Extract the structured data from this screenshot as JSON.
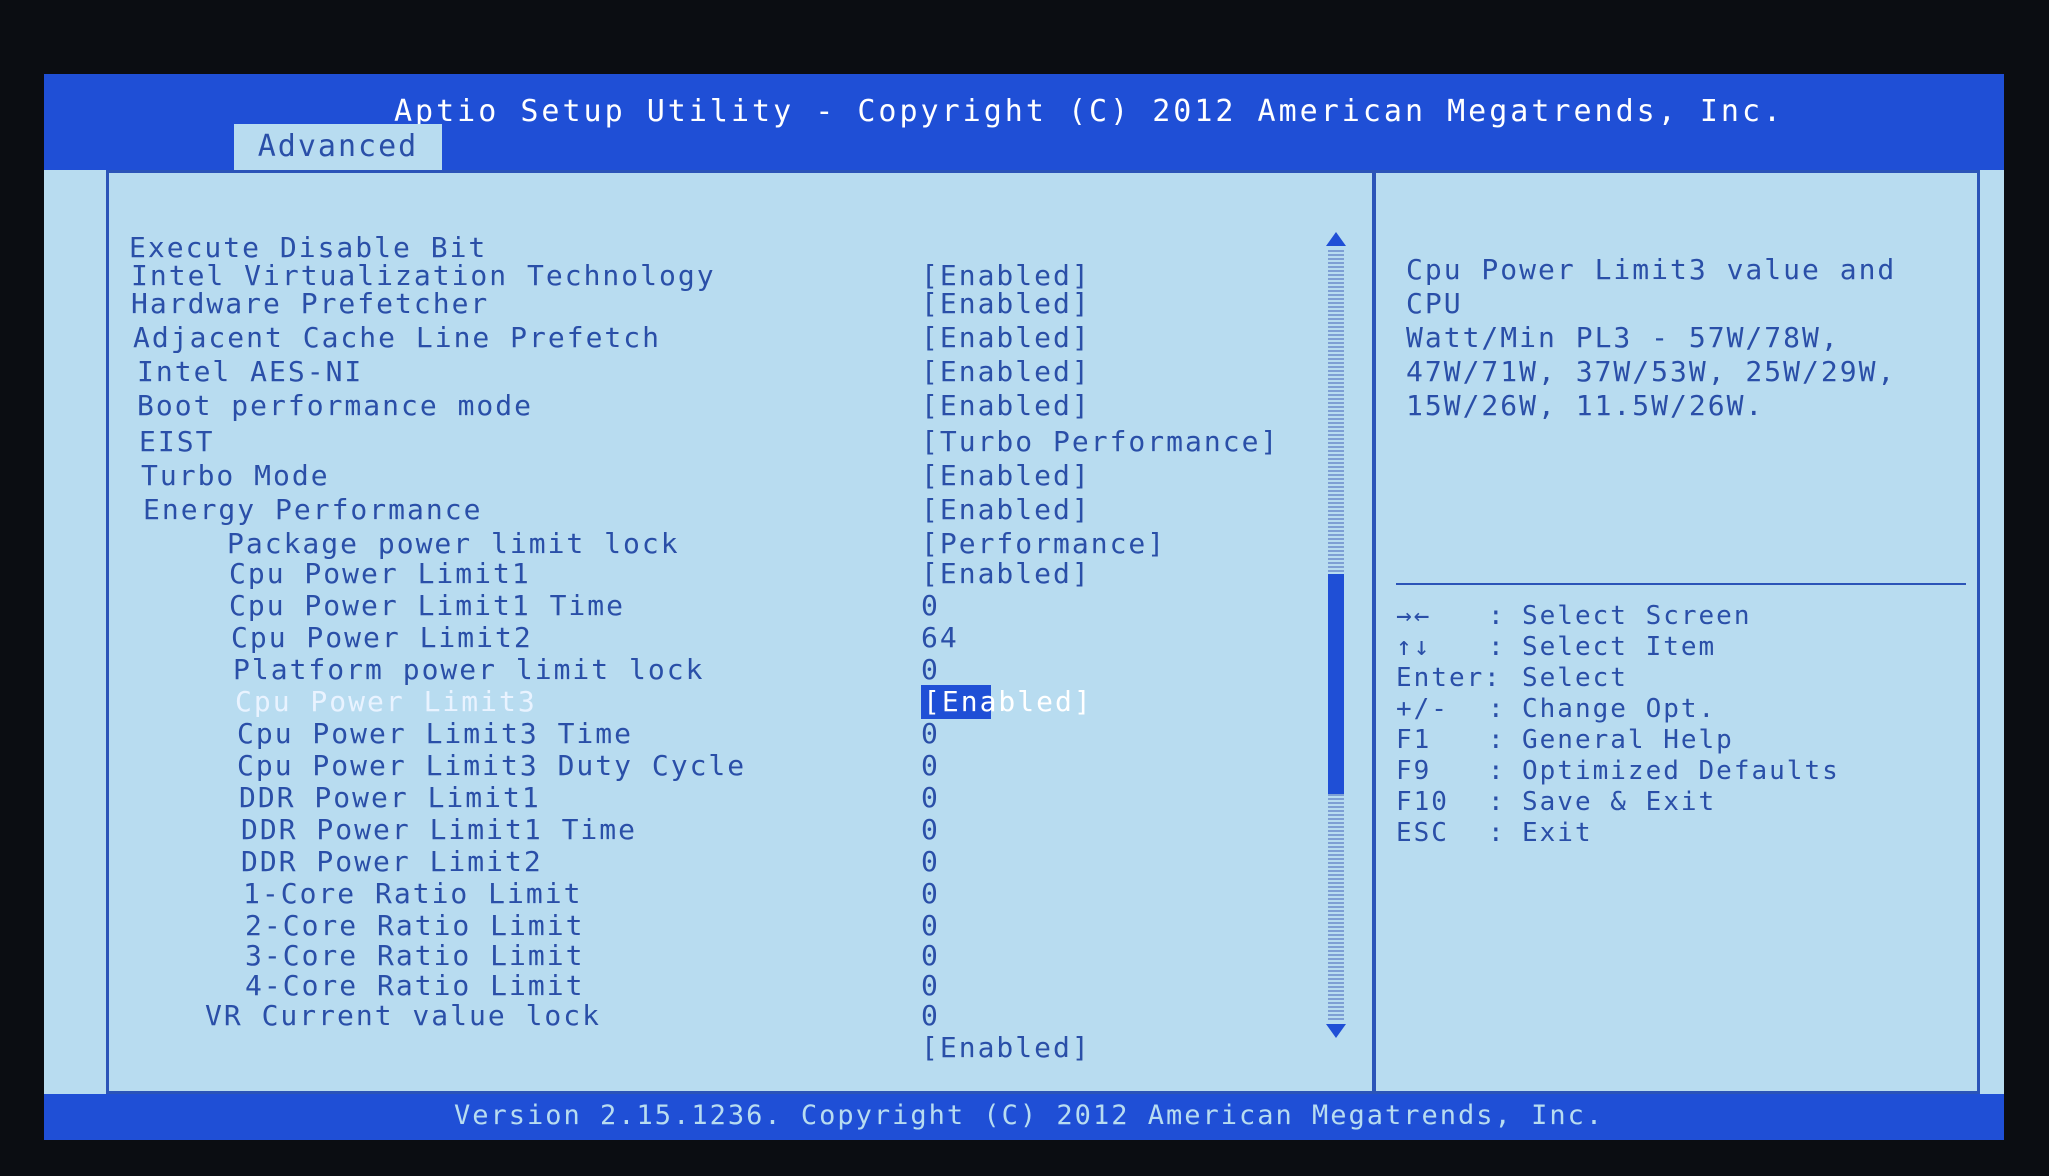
{
  "header": {
    "title": "Aptio Setup Utility - Copyright (C) 2012 American Megatrends, Inc.",
    "active_tab": "Advanced"
  },
  "settings": [
    {
      "label": "Execute Disable Bit",
      "value": "[Enabled]"
    },
    {
      "label": "Intel Virtualization Technology",
      "value": "[Enabled]"
    },
    {
      "label": "Hardware Prefetcher",
      "value": "[Enabled]"
    },
    {
      "label": "Adjacent Cache Line Prefetch",
      "value": "[Enabled]"
    },
    {
      "label": "Intel AES-NI",
      "value": "[Enabled]"
    },
    {
      "label": "Boot performance mode",
      "value": "[Turbo Performance]"
    },
    {
      "label": "EIST",
      "value": "[Enabled]"
    },
    {
      "label": "Turbo Mode",
      "value": "[Enabled]"
    },
    {
      "label": "Energy Performance",
      "value": "[Performance]"
    },
    {
      "label": "Package power limit lock",
      "value": "[Enabled]"
    },
    {
      "label": "Cpu Power Limit1",
      "value": "0"
    },
    {
      "label": "Cpu Power Limit1 Time",
      "value": "64"
    },
    {
      "label": "Cpu Power Limit2",
      "value": "0"
    },
    {
      "label": "Platform power limit lock",
      "value": "[Enabled]"
    },
    {
      "label": "Cpu Power Limit3",
      "value": "0"
    },
    {
      "label": "Cpu Power Limit3 Time",
      "value": "0"
    },
    {
      "label": "Cpu Power Limit3 Duty Cycle",
      "value": "0"
    },
    {
      "label": "DDR Power Limit1",
      "value": "0"
    },
    {
      "label": "DDR Power Limit1 Time",
      "value": "0"
    },
    {
      "label": "DDR Power Limit2",
      "value": "0"
    },
    {
      "label": "1-Core Ratio Limit",
      "value": "0"
    },
    {
      "label": "2-Core Ratio Limit",
      "value": "0"
    },
    {
      "label": "3-Core Ratio Limit",
      "value": "0"
    },
    {
      "label": "4-Core Ratio Limit",
      "value": "0"
    },
    {
      "label": "VR Current value lock",
      "value": "[Enabled]"
    }
  ],
  "help": {
    "lines": [
      "Cpu Power Limit3 value and CPU",
      "Watt/Min PL3 - 57W/78W,",
      "47W/71W, 37W/53W, 25W/29W,",
      "15W/26W, 11.5W/26W."
    ]
  },
  "keys": [
    {
      "key": "→←",
      "desc": "Select Screen"
    },
    {
      "key": "↑↓",
      "desc": "Select Item"
    },
    {
      "key": "Enter",
      "desc": "Select"
    },
    {
      "key": "+/-",
      "desc": "Change Opt."
    },
    {
      "key": "F1",
      "desc": "General Help"
    },
    {
      "key": "F9",
      "desc": "Optimized Defaults"
    },
    {
      "key": "F10",
      "desc": "Save & Exit"
    },
    {
      "key": "ESC",
      "desc": "Exit"
    }
  ],
  "footer": {
    "text": "Version 2.15.1236. Copyright (C) 2012 American Megatrends, Inc."
  }
}
